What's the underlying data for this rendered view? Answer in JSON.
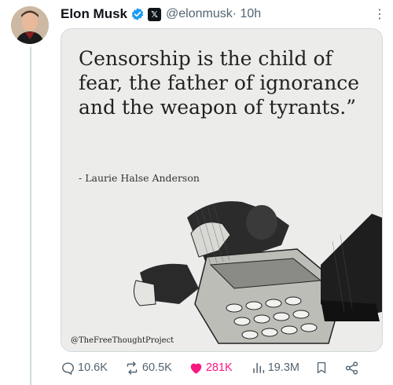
{
  "tweet": {
    "author_name": "Elon Musk",
    "handle": "@elonmusk",
    "time": " · 10h",
    "more": "⋮"
  },
  "media": {
    "quote": "Censorship is the child of fear, the father of ignorance and the weapon of tyrants.”",
    "author": "- Laurie Halse Anderson",
    "credit": "@TheFreeThoughtProject"
  },
  "actions": {
    "replies": "10.6K",
    "reposts": "60.5K",
    "likes": "281K",
    "views": "19.3M"
  },
  "colors": {
    "verified": "#1d9bf0",
    "like": "#f91880",
    "muted": "#536471"
  },
  "icons": [
    "verified-icon",
    "x-badge-icon",
    "more-icon",
    "reply-icon",
    "repost-icon",
    "like-icon",
    "views-icon",
    "bookmark-icon",
    "share-icon"
  ]
}
